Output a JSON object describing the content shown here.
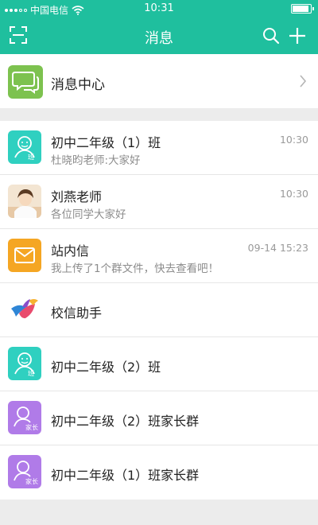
{
  "status_bar": {
    "carrier": "中国电信",
    "time": "10:31"
  },
  "header": {
    "title": "消息",
    "icons": [
      "scan-icon",
      "search-icon",
      "plus-icon"
    ]
  },
  "message_center": {
    "label": "消息中心",
    "icon": "chat-bubbles-icon"
  },
  "conversations": [
    {
      "name": "初中二年级（1）班",
      "preview": "杜晓昀老师:大家好",
      "time": "10:30",
      "avatar": "class-avatar",
      "avatar_text": "班",
      "color": "#2fd0c0"
    },
    {
      "name": "刘燕老师",
      "preview": "各位同学大家好",
      "time": "10:30",
      "avatar": "photo-avatar"
    },
    {
      "name": "站内信",
      "preview": "我上传了1个群文件，快去查看吧！",
      "time": "09-14 15:23",
      "avatar": "mail-avatar",
      "color": "#f5a623"
    },
    {
      "name": "校信助手",
      "avatar": "bird-logo"
    },
    {
      "name": "初中二年级（2）班",
      "avatar": "class-avatar",
      "avatar_text": "班",
      "color": "#2fd0c0"
    },
    {
      "name": "初中二年级（2）班家长群",
      "avatar": "parent-avatar",
      "avatar_text": "家长",
      "color": "#b07be8"
    },
    {
      "name": "初中二年级（1）班家长群",
      "avatar": "parent-avatar",
      "avatar_text": "家长",
      "color": "#b07be8"
    }
  ],
  "colors": {
    "header": "#1fbf9e",
    "message_center_icon": "#7dc24f"
  }
}
